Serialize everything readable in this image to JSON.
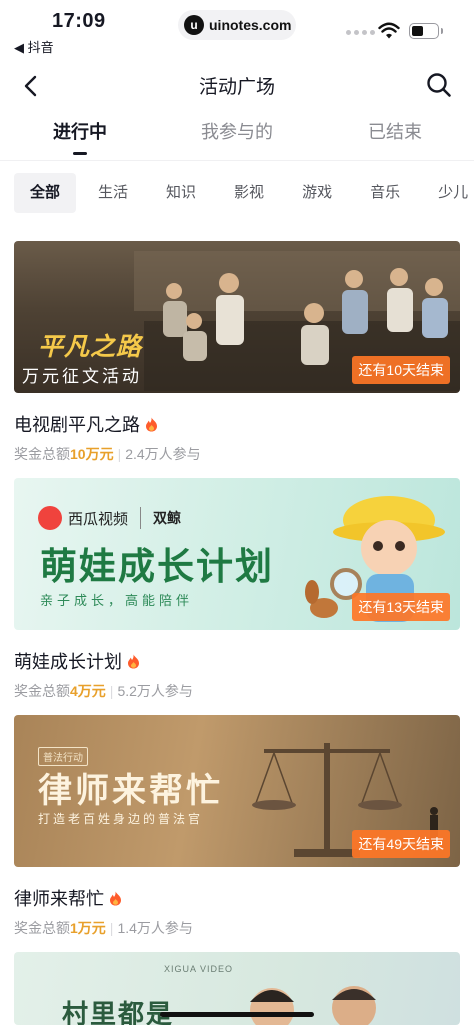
{
  "status_bar": {
    "time": "17:09",
    "back_app": "◀ 抖音",
    "url": "uinotes.com",
    "url_logo": "u"
  },
  "nav": {
    "title": "活动广场",
    "back_icon": "chevron-left-icon",
    "search_icon": "search-icon"
  },
  "tabs": [
    {
      "label": "进行中",
      "active": true
    },
    {
      "label": "我参与的",
      "active": false
    },
    {
      "label": "已结束",
      "active": false
    }
  ],
  "chips": [
    "全部",
    "生活",
    "知识",
    "影视",
    "游戏",
    "音乐",
    "少儿"
  ],
  "cards": [
    {
      "banner_logo": "平凡之路",
      "banner_sub": "万元征文活动",
      "countdown": "还有10天结束",
      "title": "电视剧平凡之路",
      "prize_label": "奖金总额",
      "prize_amount": "10万元",
      "participants": "2.4万人参与"
    },
    {
      "banner_brand": "西瓜视频",
      "banner_co": "双鲸",
      "banner_title": "萌娃成长计划",
      "banner_sub": "亲子成长，高能陪伴",
      "countdown": "还有13天结束",
      "title": "萌娃成长计划",
      "prize_label": "奖金总额",
      "prize_amount": "4万元",
      "participants": "5.2万人参与"
    },
    {
      "banner_tag": "普法行动",
      "banner_title": "律师来帮忙",
      "banner_sub": "打造老百姓身边的普法官",
      "countdown": "还有49天结束",
      "title": "律师来帮忙",
      "prize_label": "奖金总额",
      "prize_amount": "1万元",
      "participants": "1.4万人参与"
    },
    {
      "banner_brand": "XIGUA VIDEO",
      "banner_title": "村里都是"
    }
  ],
  "colors": {
    "accent_orange": "#fe7626",
    "amount_gold": "#e8a02b",
    "text_primary": "#161823",
    "text_secondary": "#9b9ca1"
  }
}
